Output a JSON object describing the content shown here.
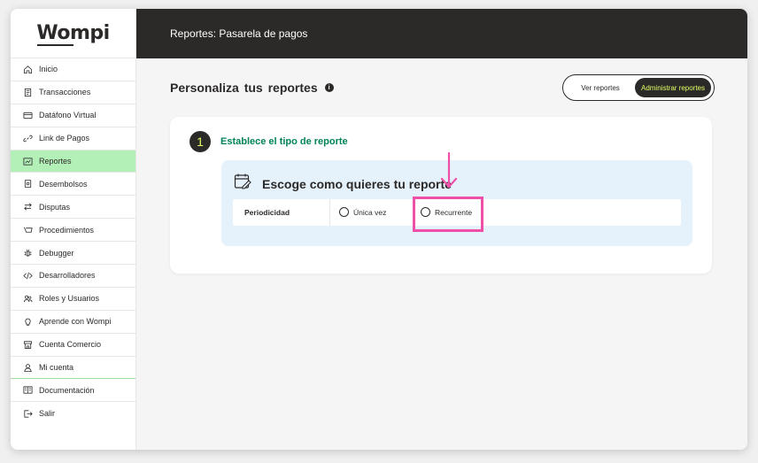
{
  "brand": {
    "logo_text": "Wompi"
  },
  "header": {
    "title": "Reportes: Pasarela de pagos"
  },
  "sidebar": {
    "items": [
      {
        "label": "Inicio",
        "icon": "home-icon",
        "active": false
      },
      {
        "label": "Transacciones",
        "icon": "receipt-icon",
        "active": false
      },
      {
        "label": "Datáfono Virtual",
        "icon": "card-terminal-icon",
        "active": false
      },
      {
        "label": "Link de Pagos",
        "icon": "link-icon",
        "active": false
      },
      {
        "label": "Reportes",
        "icon": "report-icon",
        "active": true
      },
      {
        "label": "Desembolsos",
        "icon": "money-icon",
        "active": false
      },
      {
        "label": "Disputas",
        "icon": "swap-arrows-icon",
        "active": false
      },
      {
        "label": "Procedimientos",
        "icon": "procedures-icon",
        "active": false
      },
      {
        "label": "Debugger",
        "icon": "bug-icon",
        "active": false
      },
      {
        "label": "Desarrolladores",
        "icon": "code-icon",
        "active": false
      },
      {
        "label": "Roles y Usuarios",
        "icon": "users-icon",
        "active": false
      },
      {
        "label": "Aprende con Wompi",
        "icon": "lightbulb-icon",
        "active": false
      },
      {
        "label": "Cuenta Comercio",
        "icon": "store-icon",
        "active": false
      },
      {
        "label": "Mi cuenta",
        "icon": "user-icon",
        "active": false
      },
      {
        "label": "Documentación",
        "icon": "document-icon",
        "active": false
      },
      {
        "label": "Salir",
        "icon": "logout-icon",
        "active": false
      }
    ]
  },
  "main": {
    "title": "Personaliza  tus reportes",
    "info_icon_glyph": "i",
    "toggle": {
      "view_label": "Ver reportes",
      "admin_label": "Administrar reportes",
      "selected": "Administrar reportes"
    },
    "step": {
      "number": "1",
      "title": "Establece el tipo de reporte"
    },
    "panel": {
      "title": "Escoge como quieres tu reporte",
      "row_label": "Periodicidad",
      "options": [
        {
          "label": "Única vez",
          "selected": false
        },
        {
          "label": "Recurrente",
          "selected": false
        }
      ]
    }
  },
  "colors": {
    "dark": "#2c2a29",
    "accent_green": "#00825a",
    "active_nav": "#b3f0b8",
    "lime": "#dfff61",
    "highlight_pink": "#f04fa7",
    "panel_blue": "#e6f2fb"
  }
}
